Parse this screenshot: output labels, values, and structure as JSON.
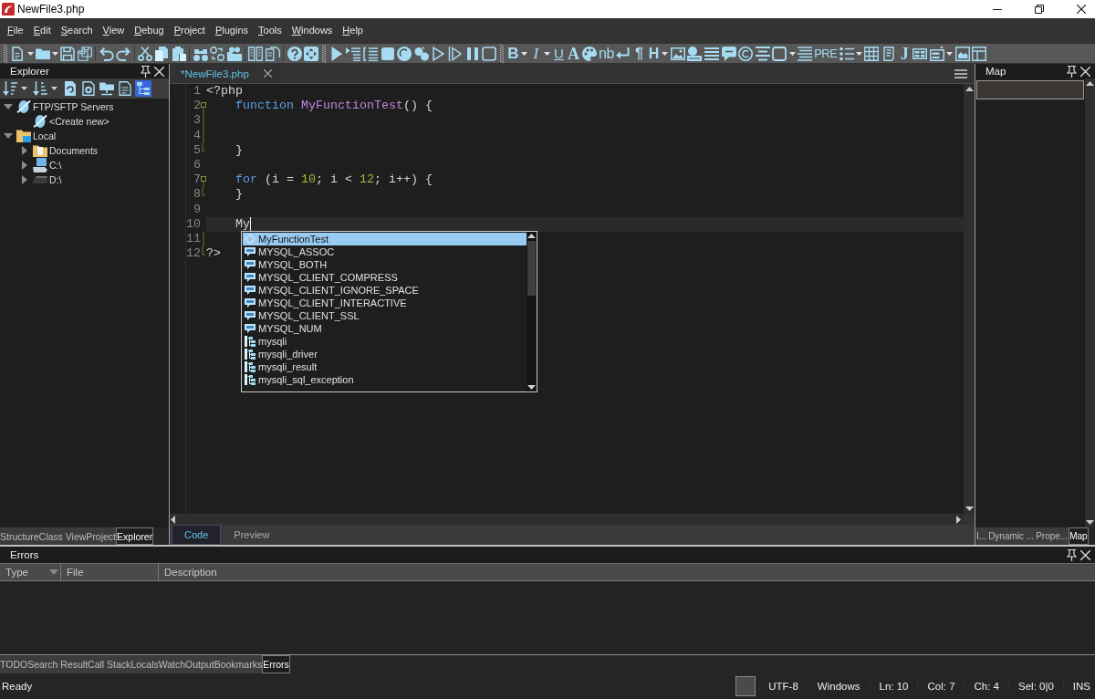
{
  "window": {
    "title": "NewFile3.php"
  },
  "menu": [
    {
      "label": "File"
    },
    {
      "label": "Edit"
    },
    {
      "label": "Search"
    },
    {
      "label": "View"
    },
    {
      "label": "Debug"
    },
    {
      "label": "Project"
    },
    {
      "label": "Plugins"
    },
    {
      "label": "Tools"
    },
    {
      "label": "Windows"
    },
    {
      "label": "Help"
    }
  ],
  "toolbar": {
    "text_buttons": [
      {
        "label": "B",
        "kind": "bold"
      },
      {
        "label": "I",
        "kind": "italic"
      },
      {
        "label": "U",
        "kind": "underline"
      },
      {
        "label": "A",
        "kind": "font"
      },
      {
        "label": "nb",
        "kind": "nbsp"
      },
      {
        "label": "¶",
        "kind": "paragraph"
      },
      {
        "label": "H",
        "kind": "heading"
      },
      {
        "label": "PRE",
        "kind": "preformatted"
      },
      {
        "label": "J",
        "kind": "script"
      }
    ]
  },
  "explorer": {
    "title": "Explorer",
    "toolbar": [
      {
        "selected": false
      },
      {
        "selected": false
      },
      {
        "selected": false
      },
      {
        "selected": false
      },
      {
        "selected": false
      },
      {
        "selected": false
      },
      {
        "selected": true
      }
    ],
    "tree": [
      {
        "label": "FTP/SFTP Servers",
        "kind": "server",
        "expanded": true,
        "children": [
          {
            "label": "<Create new>",
            "kind": "server"
          }
        ]
      },
      {
        "label": "Local",
        "kind": "local",
        "expanded": true,
        "children": [
          {
            "label": "Documents",
            "kind": "folder",
            "expanded": false
          },
          {
            "label": "C:\\",
            "kind": "computer",
            "expanded": false
          },
          {
            "label": "D:\\",
            "kind": "drive",
            "expanded": false
          }
        ]
      }
    ],
    "tabs": [
      {
        "label": "Structure",
        "selected": false
      },
      {
        "label": "Class View",
        "selected": false
      },
      {
        "label": "Project",
        "selected": false
      },
      {
        "label": "Explorer",
        "selected": true
      }
    ]
  },
  "editor": {
    "tabs": [
      {
        "label": "*NewFile3.php",
        "selected": true
      }
    ],
    "lines": [
      {
        "number": "1",
        "kind": "plain",
        "current": false,
        "tokens": [
          {
            "text": "<?php",
            "kind": "plain"
          }
        ]
      },
      {
        "number": "2",
        "kind": "fold-start",
        "current": false,
        "tokens": [
          {
            "text": "    function ",
            "kind": "keyword"
          },
          {
            "text": "MyFunctionTest",
            "kind": "function"
          },
          {
            "text": "() {",
            "kind": "plain"
          }
        ]
      },
      {
        "number": "3",
        "kind": "fold-body",
        "current": false
      },
      {
        "number": "4",
        "kind": "fold-body",
        "current": false
      },
      {
        "number": "5",
        "kind": "fold-end",
        "current": false,
        "tokens": [
          {
            "text": "    }",
            "kind": "plain"
          }
        ]
      },
      {
        "number": "6",
        "kind": "plain",
        "current": false
      },
      {
        "number": "7",
        "kind": "fold-start",
        "current": false,
        "tokens": [
          {
            "text": "    for",
            "kind": "keyword"
          },
          {
            "text": " (i = ",
            "kind": "plain"
          },
          {
            "text": "10",
            "kind": "number"
          },
          {
            "text": "; i < ",
            "kind": "plain"
          },
          {
            "text": "12",
            "kind": "number"
          },
          {
            "text": "; i++) {",
            "kind": "plain"
          }
        ]
      },
      {
        "number": "8",
        "kind": "fold-end",
        "current": false,
        "tokens": [
          {
            "text": "    }",
            "kind": "plain"
          }
        ]
      },
      {
        "number": "9",
        "kind": "plain",
        "current": false
      },
      {
        "number": "10",
        "kind": "plain",
        "current": true,
        "tokens": [
          {
            "text": "    My",
            "kind": "plain"
          }
        ]
      },
      {
        "number": "11",
        "kind": "fold-body",
        "current": false
      },
      {
        "number": "12",
        "kind": "fold-end",
        "current": false,
        "tokens": [
          {
            "text": "?>",
            "kind": "plain"
          }
        ]
      }
    ],
    "autocomplete": [
      {
        "label": "MyFunctionTest",
        "kind": "function",
        "selected": true
      },
      {
        "label": "MYSQL_ASSOC",
        "kind": "constant",
        "selected": false
      },
      {
        "label": "MYSQL_BOTH",
        "kind": "constant",
        "selected": false
      },
      {
        "label": "MYSQL_CLIENT_COMPRESS",
        "kind": "constant",
        "selected": false
      },
      {
        "label": "MYSQL_CLIENT_IGNORE_SPACE",
        "kind": "constant",
        "selected": false
      },
      {
        "label": "MYSQL_CLIENT_INTERACTIVE",
        "kind": "constant",
        "selected": false
      },
      {
        "label": "MYSQL_CLIENT_SSL",
        "kind": "constant",
        "selected": false
      },
      {
        "label": "MYSQL_NUM",
        "kind": "constant",
        "selected": false
      },
      {
        "label": "mysqli",
        "kind": "class",
        "selected": false
      },
      {
        "label": "mysqli_driver",
        "kind": "class",
        "selected": false
      },
      {
        "label": "mysqli_result",
        "kind": "class",
        "selected": false
      },
      {
        "label": "mysqli_sql_exception",
        "kind": "class",
        "selected": false
      }
    ],
    "view_tabs": [
      {
        "label": "Code",
        "selected": true
      },
      {
        "label": "Preview",
        "selected": false
      }
    ]
  },
  "map": {
    "title": "Map",
    "tabs": [
      {
        "label": "I...",
        "selected": false
      },
      {
        "label": "Dynamic ...",
        "selected": false
      },
      {
        "label": "Prope...",
        "selected": false
      },
      {
        "label": "Map",
        "selected": true
      }
    ]
  },
  "errors": {
    "title": "Errors",
    "columns": [
      {
        "label": "Type",
        "sorted": true
      },
      {
        "label": "File",
        "sorted": false
      },
      {
        "label": "Description",
        "sorted": false
      }
    ]
  },
  "bottom_tabs": [
    {
      "label": "TODO",
      "selected": false
    },
    {
      "label": "Search Result",
      "selected": false
    },
    {
      "label": "Call Stack",
      "selected": false
    },
    {
      "label": "Locals",
      "selected": false
    },
    {
      "label": "Watch",
      "selected": false
    },
    {
      "label": "Output",
      "selected": false
    },
    {
      "label": "Bookmarks",
      "selected": false
    },
    {
      "label": "Errors",
      "selected": true
    }
  ],
  "status_bar": {
    "message": "Ready",
    "fields": [
      "UTF-8",
      "Windows",
      "Ln: 10",
      "Col: 7",
      "Ch: 4",
      "Sel: 0|0",
      "INS"
    ]
  }
}
